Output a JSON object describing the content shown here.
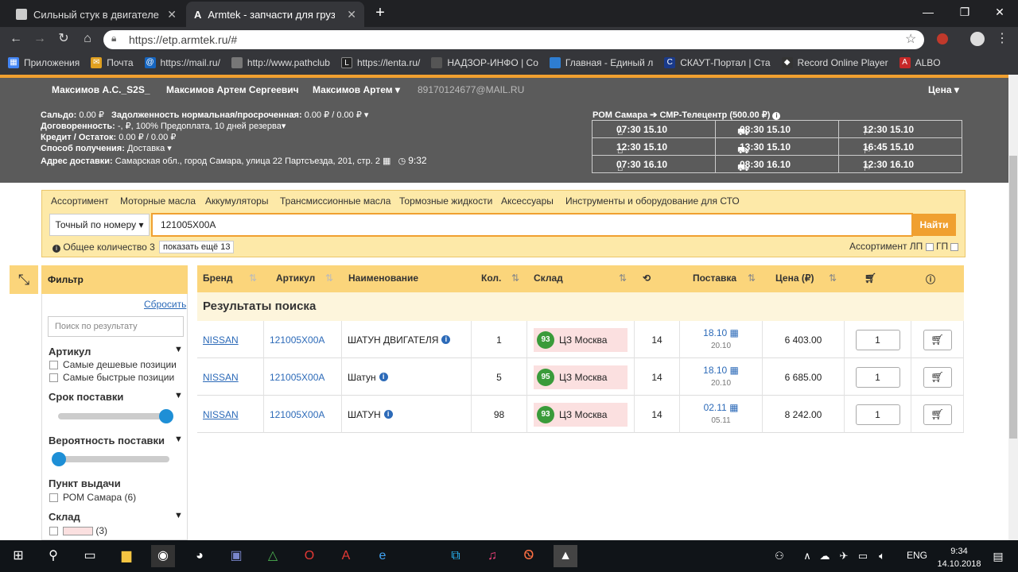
{
  "browser": {
    "tabs": [
      {
        "title": "Сильный стук в двигателе"
      },
      {
        "title": "Armtek - запчасти для грузовых"
      }
    ],
    "url": "https://etp.armtek.ru/#",
    "bookmarks": [
      "Приложения",
      "Почта",
      "https://mail.ru/",
      "http://www.pathclub",
      "https://lenta.ru/",
      "НАДЗОР-ИНФО | Со",
      "Главная - Единый л",
      "СКАУТ-Портал | Ста",
      "Record Online Player",
      "ALBO"
    ]
  },
  "header": {
    "user1": "Максимов А.С._S2S_",
    "user2": "Максимов Артем Сергеевич",
    "user3": "Максимов Артем",
    "email": "89170124677@MAIL.RU",
    "price_menu": "Цена",
    "saldo_label": "Сальдо:",
    "saldo_value": "0.00 ₽",
    "debt_label": "Задолженность нормальная/просроченная:",
    "debt_value": "0.00 ₽ / 0.00 ₽",
    "agreement_label": "Договоренность:",
    "agreement_value": "-, ₽, 100% Предоплата, 10 дней резерва",
    "credit_label": "Кредит / Остаток:",
    "credit_value": "0.00 ₽ / 0.00 ₽",
    "delivery_label": "Способ получения:",
    "delivery_value": "Доставка",
    "address_label": "Адрес доставки:",
    "address_value": "Самарская обл., город Самара, улица 22 Партсъезда, 201, стр. 2",
    "time": "9:32",
    "route": "РОМ Самара ➔ СМР-Телецентр (500.00 ₽)",
    "schedule": [
      [
        "07:30 15.10",
        "08:30 15.10",
        "12:30 15.10"
      ],
      [
        "12:30 15.10",
        "13:30 15.10",
        "16:45 15.10"
      ],
      [
        "07:30 16.10",
        "08:30 16.10",
        "12:30 16.10"
      ]
    ]
  },
  "categories": [
    "Ассортимент",
    "Моторные масла",
    "Аккумуляторы",
    "Трансмиссионные масла",
    "Тормозные жидкости",
    "Аксессуары",
    "Инструменты и оборудование для СТО"
  ],
  "search": {
    "mode": "Точный по номеру",
    "query": "121005X00A",
    "button": "Найти",
    "total": "Общее количество 3",
    "show_more": "показать ещё 13",
    "assortment": "Ассортимент ЛП",
    "gp": "ГП"
  },
  "filter": {
    "title": "Фильтр",
    "reset": "Сбросить",
    "placeholder": "Поиск по результату",
    "article": "Артикул",
    "cheap": "Самые дешевые позиции",
    "fast": "Самые быстрые позиции",
    "term": "Срок поставки",
    "term_level": 1.0,
    "probability": "Вероятность поставки",
    "probability_level": 0.0,
    "pickup": "Пункт выдачи",
    "pickup_item": "РОМ Самара (6)",
    "warehouse": "Склад",
    "warehouse_count": "(3)"
  },
  "table": {
    "columns": [
      "Бренд",
      "Артикул",
      "Наименование",
      "Кол.",
      "Склад",
      "Поставка",
      "Цена (₽)"
    ],
    "results_title": "Результаты поиска",
    "rows": [
      {
        "brand": "NISSAN",
        "article": "121005X00A",
        "name": "ШАТУН ДВИГАТЕЛЯ",
        "qty": "1",
        "score": "93",
        "warehouse": "ЦЗ Москва",
        "days": "14",
        "date": "18.10",
        "date2": "20.10",
        "price": "6 403.00",
        "order_qty": "1"
      },
      {
        "brand": "NISSAN",
        "article": "121005X00A",
        "name": "Шатун",
        "qty": "5",
        "score": "95",
        "warehouse": "ЦЗ Москва",
        "days": "14",
        "date": "18.10",
        "date2": "20.10",
        "price": "6 685.00",
        "order_qty": "1"
      },
      {
        "brand": "NISSAN",
        "article": "121005X00A",
        "name": "ШАТУН",
        "qty": "98",
        "score": "93",
        "warehouse": "ЦЗ Москва",
        "days": "14",
        "date": "02.11",
        "date2": "05.11",
        "price": "8 242.00",
        "order_qty": "1"
      }
    ]
  },
  "taskbar": {
    "lang": "ENG",
    "time": "9:34",
    "date": "14.10.2018"
  }
}
